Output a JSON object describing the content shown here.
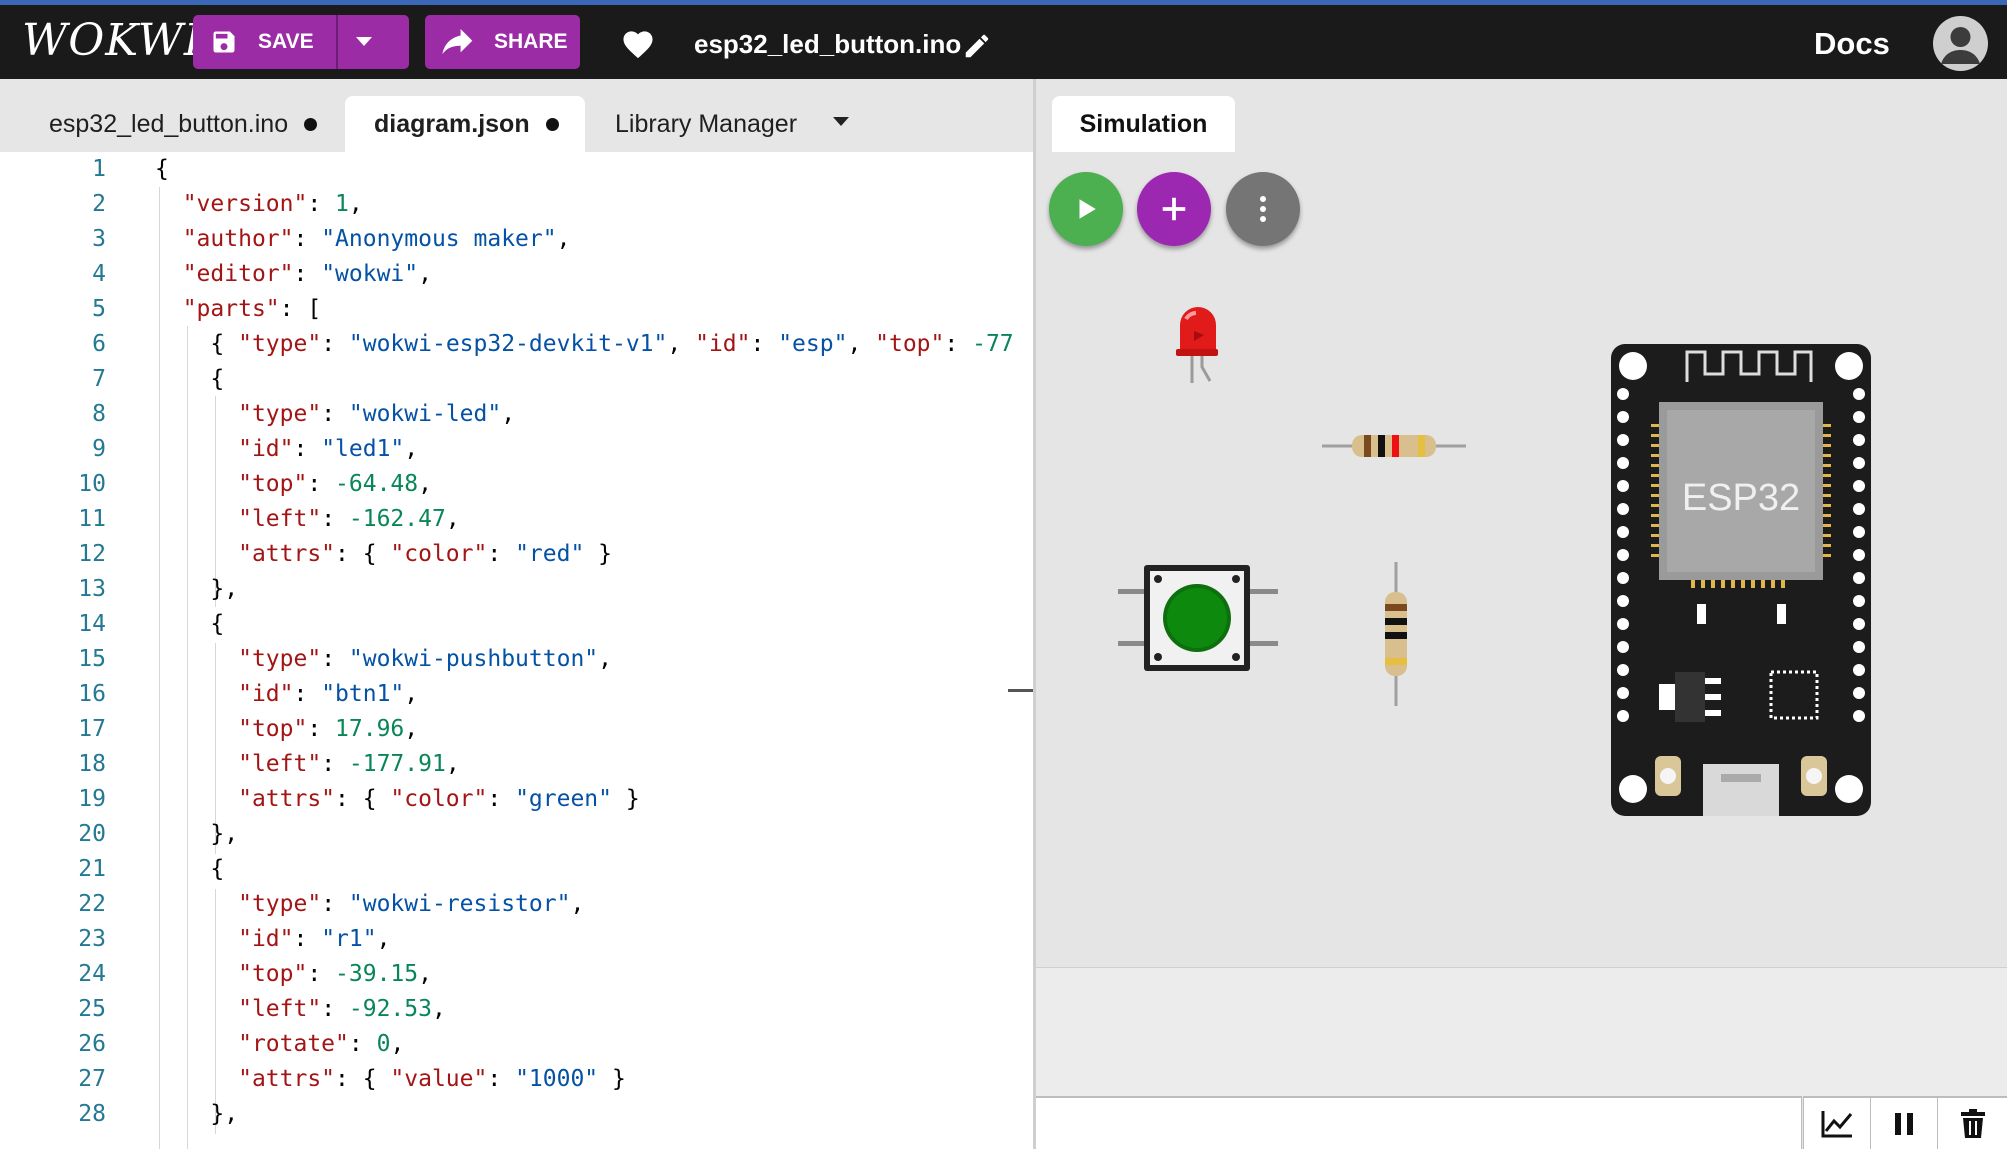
{
  "app": {
    "logo": "WOKWI",
    "filename": "esp32_led_button.ino",
    "docs": "Docs"
  },
  "toolbar": {
    "save_label": "SAVE",
    "share_label": "SHARE"
  },
  "tabs": [
    {
      "label": "esp32_led_button.ino",
      "modified": true
    },
    {
      "label": "diagram.json",
      "modified": true,
      "active": true
    },
    {
      "label": "Library Manager"
    }
  ],
  "simulation": {
    "tab_label": "Simulation",
    "board_label": "ESP32"
  },
  "editor": {
    "line_numbers": [
      "1",
      "2",
      "3",
      "4",
      "5",
      "6",
      "7",
      "8",
      "9",
      "10",
      "11",
      "12",
      "13",
      "14",
      "15",
      "16",
      "17",
      "18",
      "19",
      "20",
      "21",
      "22",
      "23",
      "24",
      "25",
      "26",
      "27",
      "28"
    ],
    "lines": [
      "{",
      "  \"version\": 1,",
      "  \"author\": \"Anonymous maker\",",
      "  \"editor\": \"wokwi\",",
      "  \"parts\": [",
      "    { \"type\": \"wokwi-esp32-devkit-v1\", \"id\": \"esp\", \"top\": -77",
      "    {",
      "      \"type\": \"wokwi-led\",",
      "      \"id\": \"led1\",",
      "      \"top\": -64.48,",
      "      \"left\": -162.47,",
      "      \"attrs\": { \"color\": \"red\" }",
      "    },",
      "    {",
      "      \"type\": \"wokwi-pushbutton\",",
      "      \"id\": \"btn1\",",
      "      \"top\": 17.96,",
      "      \"left\": -177.91,",
      "      \"attrs\": { \"color\": \"green\" }",
      "    },",
      "    {",
      "      \"type\": \"wokwi-resistor\",",
      "      \"id\": \"r1\",",
      "      \"top\": -39.15,",
      "      \"left\": -92.53,",
      "      \"rotate\": 0,",
      "      \"attrs\": { \"value\": \"1000\" }",
      "    },"
    ]
  },
  "colors": {
    "header_bg": "#1a1a1a",
    "accent_purple": "#9c2ca6",
    "play_green": "#4caf50",
    "add_purple": "#9c27b0",
    "json_key": "#a31515",
    "json_string": "#0451a5",
    "json_number": "#098658",
    "line_number": "#237893"
  },
  "icons": [
    "save-icon",
    "chevron-down-icon",
    "share-icon",
    "heart-icon",
    "pencil-icon",
    "account-icon",
    "play-icon",
    "plus-icon",
    "more-vert-icon",
    "chart-icon",
    "pause-icon",
    "trash-icon"
  ]
}
